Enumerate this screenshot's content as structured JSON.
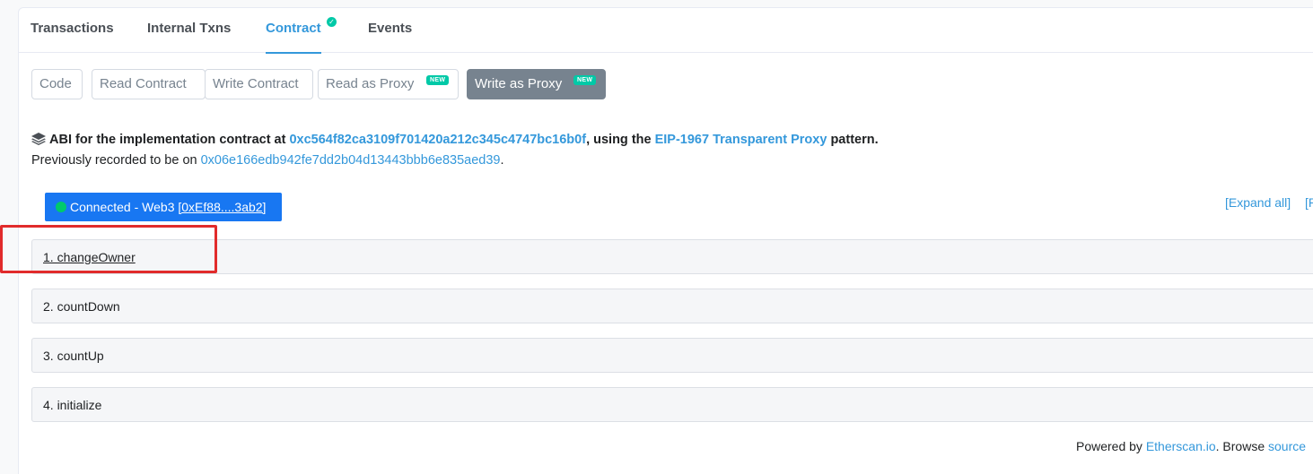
{
  "tabs": [
    {
      "label": "Transactions"
    },
    {
      "label": "Internal Txns"
    },
    {
      "label": "Contract"
    },
    {
      "label": "Events"
    }
  ],
  "subtabs": [
    {
      "label": "Code"
    },
    {
      "label": "Read Contract"
    },
    {
      "label": "Write Contract"
    },
    {
      "label": "Read as Proxy",
      "badge": "NEW"
    },
    {
      "label": "Write as Proxy",
      "badge": "NEW"
    }
  ],
  "abi": {
    "prefix": "ABI for the implementation contract at ",
    "address": "0xc564f82ca3109f701420a212c345c4747bc16b0f",
    "middle": ", using the ",
    "pattern": "EIP-1967 Transparent Proxy",
    "suffix": " pattern."
  },
  "previous": {
    "prefix": "Previously recorded to be on ",
    "address": "0x06e166edb942fe7dd2b04d13443bbb6e835aed39",
    "suffix": "."
  },
  "connect": {
    "label": "Connected - Web3 ",
    "address": "[0xEf88....3ab2]"
  },
  "controls": {
    "expand_all": "[Expand all]",
    "reset_partial": "[R"
  },
  "functions": [
    {
      "label": "1. changeOwner"
    },
    {
      "label": "2. countDown"
    },
    {
      "label": "3. countUp"
    },
    {
      "label": "4. initialize"
    }
  ],
  "footer": {
    "prefix": "Powered by ",
    "link": "Etherscan.io",
    "middle": ". Browse ",
    "partial_link": "source"
  },
  "colors": {
    "accent": "#3498db",
    "badge": "#00c9a7",
    "connect_bg": "#1877f2",
    "highlight": "#e12b2b"
  }
}
